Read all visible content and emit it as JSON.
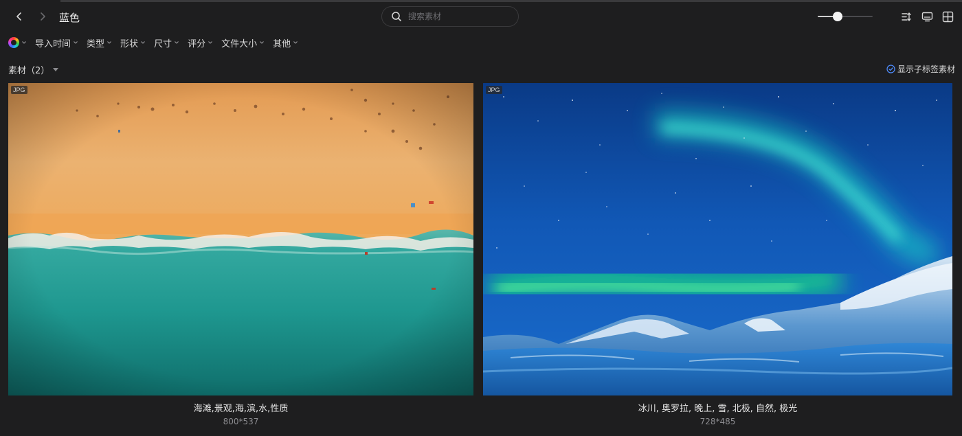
{
  "header": {
    "title": "蓝色",
    "search_placeholder": "搜索素材",
    "zoom_level": 0.35
  },
  "filters": {
    "items": [
      "导入时间",
      "类型",
      "形状",
      "尺寸",
      "评分",
      "文件大小",
      "其他"
    ]
  },
  "section": {
    "title": "素材（2）",
    "show_sub_tags_label": "显示子标签素材"
  },
  "assets": [
    {
      "badge": "JPG",
      "name": "海滩,景观,海,滨,水,性质",
      "dimensions": "800*537"
    },
    {
      "badge": "JPG",
      "name": "冰川, 奥罗拉, 晚上, 雪, 北极, 自然, 极光",
      "dimensions": "728*485"
    }
  ],
  "colors": {
    "background": "#1e1e1f",
    "accent": "#4e8cff",
    "text": "#d8d8d8"
  },
  "icons": {
    "back": "chevron-left-icon",
    "forward": "chevron-right-icon",
    "search": "search-icon",
    "sort": "sort-icon",
    "monitor": "monitor-icon",
    "layout": "grid-layout-icon",
    "check": "check-circle-icon"
  }
}
